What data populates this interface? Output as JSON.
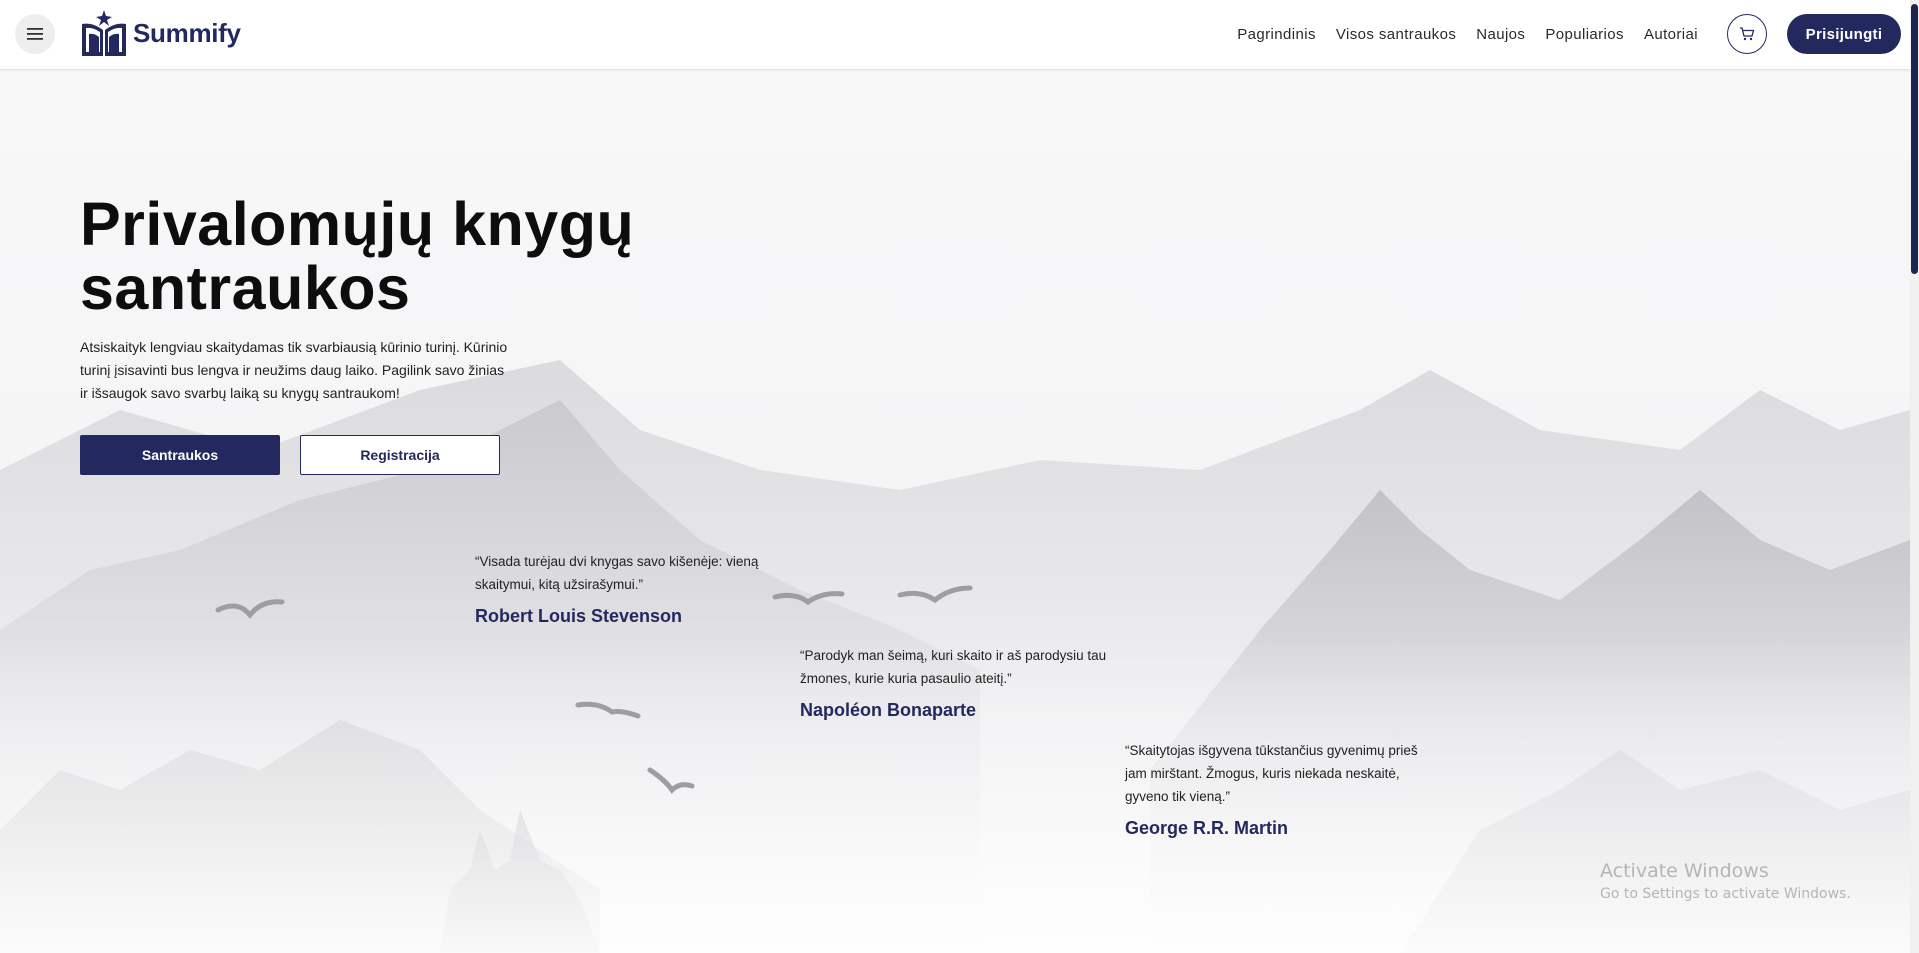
{
  "header": {
    "logo_text": "Summify",
    "nav": [
      {
        "label": "Pagrindinis"
      },
      {
        "label": "Visos santraukos"
      },
      {
        "label": "Naujos"
      },
      {
        "label": "Populiarios"
      },
      {
        "label": "Autoriai"
      }
    ],
    "login_label": "Prisijungti"
  },
  "hero": {
    "title": "Privalomųjų knygų santraukos",
    "description": "Atsiskaityk lengviau skaitydamas tik svarbiausią kūrinio turinį. Kūrinio turinį įsisavinti bus lengva ir neužims daug laiko. Pagilink savo žinias ir išsaugok savo svarbų laiką su knygų santraukom!",
    "primary_button": "Santraukos",
    "secondary_button": "Registracija"
  },
  "quotes": [
    {
      "text": "“Visada turėjau dvi knygas savo kišenėje: vieną skaitymui, kitą užsirašymui.”",
      "author": "Robert Louis Stevenson"
    },
    {
      "text": "“Parodyk man šeimą, kuri skaito ir aš parodysiu tau žmones, kurie kuria pasaulio ateitį.”",
      "author": "Napoléon Bonaparte"
    },
    {
      "text": "“Skaitytojas išgyvena tūkstančius gyvenimų prieš jam mirštant. Žmogus, kuris niekada neskaitė, gyveno tik vieną.”",
      "author": "George R.R. Martin"
    }
  ],
  "os_overlay": {
    "title": "Activate Windows",
    "subtitle": "Go to Settings to activate Windows."
  },
  "colors": {
    "brand": "#23295e",
    "background": "#f7f7f8"
  },
  "icons": [
    "hamburger-menu-icon",
    "book-star-logo-icon",
    "cart-icon",
    "bird-icon"
  ]
}
